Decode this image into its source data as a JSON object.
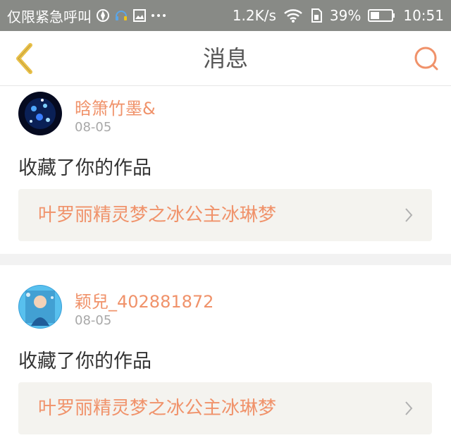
{
  "status_bar": {
    "carrier": "仅限紧急呼叫",
    "net_speed": "1.2K/s",
    "battery_pct": "39%",
    "time": "10:51",
    "icons": [
      "location-icon",
      "headset-icon",
      "image-icon",
      "more-dots-icon",
      "wifi-icon",
      "sim-icon",
      "battery-icon"
    ]
  },
  "header": {
    "title": "消息",
    "back_icon": "chevron-left-icon",
    "search_icon": "search-icon",
    "accent_color": "#f0926a"
  },
  "messages": [
    {
      "username": "晗箫竹墨&",
      "date": "08-05",
      "action": "收藏了你的作品",
      "work_title": "叶罗丽精灵梦之冰公主冰琳梦"
    },
    {
      "username": "颖兒_402881872",
      "date": "08-05",
      "action": "收藏了你的作品",
      "work_title": "叶罗丽精灵梦之冰公主冰琳梦"
    }
  ]
}
